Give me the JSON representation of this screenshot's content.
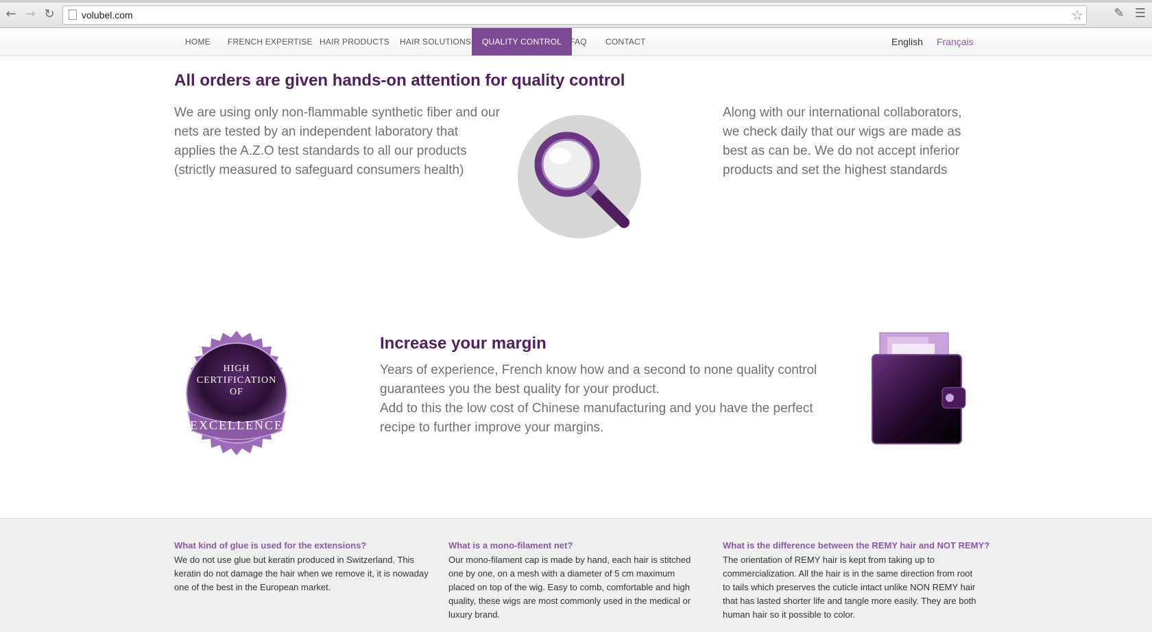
{
  "browser": {
    "url": "volubel.com",
    "back_icon": "back-arrow-icon",
    "forward_icon": "forward-arrow-icon",
    "reload_icon": "reload-icon"
  },
  "nav": {
    "items": [
      {
        "label": "HOME"
      },
      {
        "label": "FRENCH EXPERTISE"
      },
      {
        "label": "HAIR PRODUCTS"
      },
      {
        "label": "HAIR SOLUTIONS"
      },
      {
        "label": "QUALITY CONTROL",
        "active": true
      },
      {
        "label": "FAQ"
      },
      {
        "label": "CONTACT"
      }
    ],
    "languages": [
      {
        "label": "English"
      },
      {
        "label": "Français"
      }
    ],
    "active_color": "#7e4a96"
  },
  "quality": {
    "title": "All orders are given hands-on attention for quality control",
    "left_text": "We are using only non-flammable synthetic fiber and our nets are tested by an independent laboratory that applies the A.Z.O test standards to all our products (strictly measured to safeguard consumers health)",
    "right_text": "Along with our international collaborators, we check daily that our wigs are made as best as can be. We do not accept inferior products and set the highest standards"
  },
  "margin": {
    "badge_lines": [
      "HIGH",
      "CERTIFICATION",
      "OF"
    ],
    "badge_ribbon": "EXCELLENCE",
    "title": "Increase your margin",
    "text_1": "Years of experience, French know how and a second to none quality control guarantees you the best quality for your product.",
    "text_2": "Add to this the low cost of Chinese manufacturing and you have the perfect recipe to further improve your margins."
  },
  "faq": [
    {
      "question": "What kind of glue is used for the extensions?",
      "answer": "We do not use glue but keratin produced in Switzerland. This keratin do not damage the hair when we remove it, it is nowaday one of the best in the European market."
    },
    {
      "question": "What is a mono-filament net?",
      "answer": "Our mono-filament cap is made by hand, each hair is stitched one by one, on a mesh with a diameter of 5 cm maximum placed on top of the wig. Easy to comb, comfortable and high quality, these wigs are most commonly used in the medical or luxury brand."
    },
    {
      "question": "What is the difference between the REMY hair and NOT REMY?",
      "answer": "The orientation of REMY hair is kept from taking up to commercialization. All the hair is in the same direction from root to tails which preserves the cuticle intact unlike NON REMY hair that has lasted shorter life and tangle more easily. They are both human hair so it possible to color."
    }
  ],
  "colors": {
    "brand_purple": "#4f1f5e",
    "accent_purple": "#7e4a96",
    "faq_question": "#8a5aa8"
  }
}
